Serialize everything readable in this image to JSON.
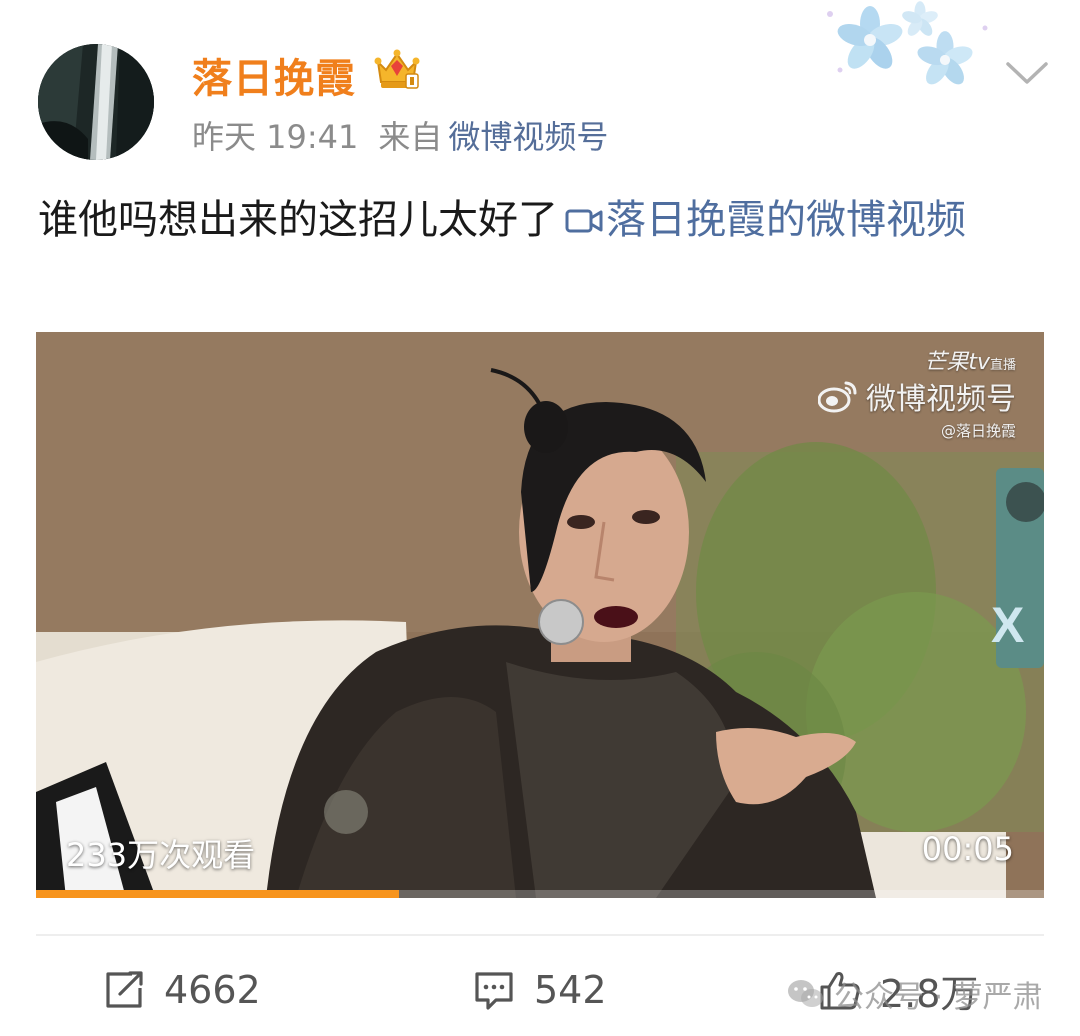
{
  "user": {
    "name": "落日挽霞",
    "time": "昨天 19:41",
    "source_prefix": "来自",
    "source": "微博视频号"
  },
  "post": {
    "text": "谁他吗想出来的这招儿太好了",
    "video_link": "落日挽霞的微博视频"
  },
  "video": {
    "views": "233万次观看",
    "duration": "00:05",
    "progress_percent": 36,
    "watermark_brand": "芒果tv",
    "watermark_brand_tag": "直播",
    "watermark_channel": "微博视频号",
    "watermark_handle": "@落日挽霞",
    "colors": {
      "progress": "#f7941d"
    }
  },
  "actions": {
    "repost_count": "4662",
    "comment_count": "542",
    "like_count": "2.8万"
  },
  "overlay": {
    "wechat_watermark": "公众号 · 萝严肃"
  },
  "colors": {
    "username": "#f07f1c",
    "link": "#4f6e9f"
  },
  "icons": [
    "verified-crown-icon",
    "chevron-down-icon",
    "video-camera-icon",
    "weibo-logo-icon",
    "repost-icon",
    "comment-icon",
    "like-icon",
    "wechat-icon"
  ]
}
